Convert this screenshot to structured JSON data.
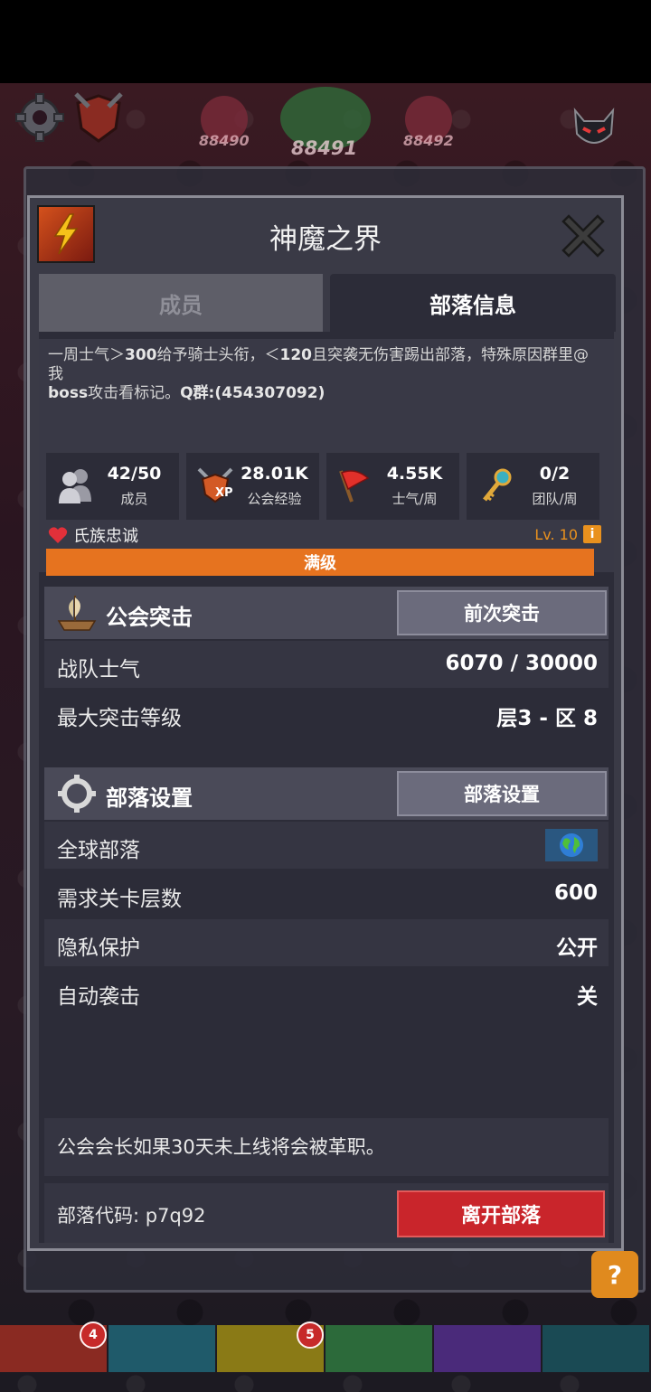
{
  "background": {
    "stages": {
      "left": "88490",
      "center": "88491",
      "right": "88492"
    }
  },
  "dialog": {
    "title": "神魔之界",
    "tabs": {
      "members": "成员",
      "clan_info": "部落信息"
    }
  },
  "info": {
    "description_line1_a": "一周士气＞",
    "description_line1_b": "300",
    "description_line1_c": "给予骑士头衔，＜",
    "description_line1_d": "120",
    "description_line1_e": "且突袭无伤害踢出部落，特殊原因群里@我",
    "description_line2_a": "boss",
    "description_line2_b": "攻击看标记。",
    "description_line2_c": "Q群:(454307092)",
    "stats": [
      {
        "icon": "members-icon",
        "value": "42/50",
        "label": "成员"
      },
      {
        "icon": "xp-shield-icon",
        "value": "28.01K",
        "label": "公会经验"
      },
      {
        "icon": "flag-icon",
        "value": "4.55K",
        "label": "士气/周"
      },
      {
        "icon": "key-icon",
        "value": "0/2",
        "label": "团队/周"
      }
    ],
    "loyalty_label": "氏族忠诚",
    "level": "Lv. 10",
    "progress_label": "满级",
    "progress_fraction": 1.0
  },
  "raid": {
    "title": "公会突击",
    "button": "前次突击",
    "rows": [
      {
        "key": "战队士气",
        "value": "6070 / 30000"
      },
      {
        "key": "最大突击等级",
        "value": "层3 - 区 8"
      }
    ]
  },
  "settings": {
    "title": "部落设置",
    "button": "部落设置",
    "global_label": "全球部落",
    "rows": [
      {
        "key": "需求关卡层数",
        "value": "600"
      },
      {
        "key": "隐私保护",
        "value": "公开"
      },
      {
        "key": "自动袭击",
        "value": "关"
      }
    ]
  },
  "notice": "公会会长如果30天未上线将会被革职。",
  "footer": {
    "code_label": "部落代码: p7q92",
    "leave_button": "离开部落"
  },
  "bottom_badges": {
    "first": "4",
    "third": "5"
  },
  "help": "?",
  "colors": {
    "accent_orange": "#e6731f",
    "danger_red": "#c9252b"
  }
}
